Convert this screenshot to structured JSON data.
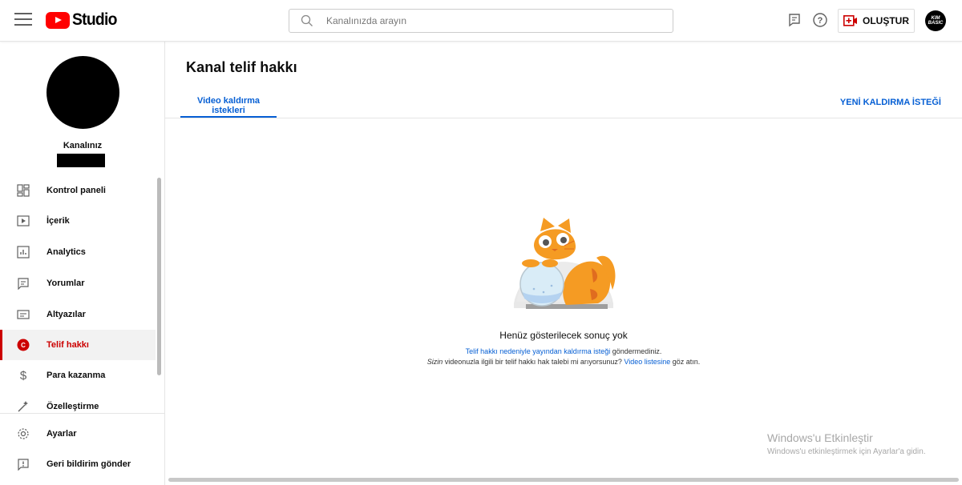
{
  "topbar": {
    "logo_text": "Studio",
    "search_placeholder": "Kanalınızda arayın",
    "create_label": "OLUŞTUR",
    "avatar_text": "KIM BASIC"
  },
  "sidebar": {
    "channel_label": "Kanalınız",
    "items": [
      {
        "label": "Kontrol paneli",
        "icon": "dashboard-icon"
      },
      {
        "label": "İçerik",
        "icon": "content-icon"
      },
      {
        "label": "Analytics",
        "icon": "analytics-icon"
      },
      {
        "label": "Yorumlar",
        "icon": "comments-icon"
      },
      {
        "label": "Altyazılar",
        "icon": "subtitles-icon"
      },
      {
        "label": "Telif hakkı",
        "icon": "copyright-icon",
        "active": true
      },
      {
        "label": "Para kazanma",
        "icon": "dollar-icon"
      },
      {
        "label": "Özelleştirme",
        "icon": "magic-wand-icon"
      }
    ],
    "bottom_items": [
      {
        "label": "Ayarlar",
        "icon": "gear-icon"
      },
      {
        "label": "Geri bildirim gönder",
        "icon": "feedback-icon"
      }
    ]
  },
  "main": {
    "title": "Kanal telif hakkı",
    "tab_label": "Video kaldırma istekleri",
    "new_request": "YENİ KALDIRMA İSTEĞİ",
    "empty": {
      "title": "Henüz gösterilecek sonuç yok",
      "line1_link": "Telif hakkı nedeniyle yayından kaldırma isteği",
      "line1_rest": " göndermediniz.",
      "line2_em": "Sizin",
      "line2_mid": " videonuzla ilgili bir telif hakkı hak talebi mi arıyorsunuz? ",
      "line2_link": "Video listesine",
      "line2_end": " göz atın."
    }
  },
  "watermark": {
    "title": "Windows'u Etkinleştir",
    "subtitle": "Windows'u etkinleştirmek için Ayarlar'a gidin."
  },
  "colors": {
    "accent": "#065fd4",
    "active_red": "#cc0000",
    "brand_red": "#ff0000"
  }
}
